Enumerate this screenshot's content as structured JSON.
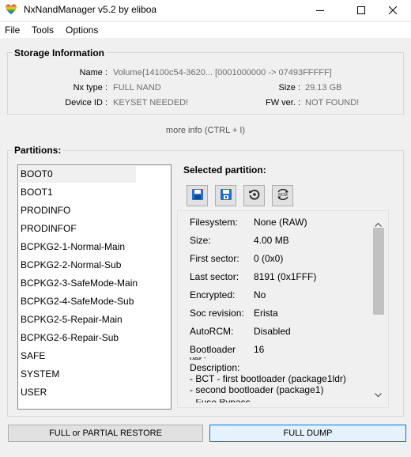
{
  "window": {
    "title": "NxNandManager v5.2 by eliboa",
    "minimize_icon": "minimize-icon",
    "maximize_icon": "maximize-icon",
    "close_icon": "close-icon"
  },
  "menu": {
    "items": [
      {
        "label": "File"
      },
      {
        "label": "Tools"
      },
      {
        "label": "Options"
      }
    ]
  },
  "storage": {
    "section_title": "Storage Information",
    "name_label": "Name :",
    "name_value": "Volume{14100c54-3620... [0001000000 -> 07493FFFFF]",
    "nx_type_label": "Nx type :",
    "nx_type_value": "FULL NAND",
    "size_label": "Size :",
    "size_value": "29.13 GB",
    "device_id_label": "Device ID :",
    "device_id_value": "KEYSET NEEDED!",
    "fw_ver_label": "FW ver. :",
    "fw_ver_value": "NOT FOUND!",
    "more_info": "more info (CTRL + I)"
  },
  "partitions": {
    "section_title": "Partitions:",
    "items": [
      "BOOT0",
      "BOOT1",
      "PRODINFO",
      "PRODINFOF",
      "BCPKG2-1-Normal-Main",
      "BCPKG2-2-Normal-Sub",
      "BCPKG2-3-SafeMode-Main",
      "BCPKG2-4-SafeMode-Sub",
      "BCPKG2-5-Repair-Main",
      "BCPKG2-6-Repair-Sub",
      "SAFE",
      "SYSTEM",
      "USER"
    ],
    "selected_index": 0
  },
  "selected_partition": {
    "title": "Selected partition:",
    "tools": [
      {
        "icon": "save-icon"
      },
      {
        "icon": "save-as-icon"
      },
      {
        "icon": "restore-icon"
      },
      {
        "icon": "autorcm-icon"
      }
    ],
    "fields": [
      {
        "label": "Filesystem:",
        "value": "None (RAW)"
      },
      {
        "label": "Size:",
        "value": "4.00 MB"
      },
      {
        "label": "First sector:",
        "value": "0 (0x0)"
      },
      {
        "label": "Last sector:",
        "value": "8191 (0x1FFF)"
      },
      {
        "label": "Encrypted:",
        "value": "No"
      },
      {
        "label": "Soc revision:",
        "value": "Erista"
      },
      {
        "label": "AutoRCM:",
        "value": "Disabled"
      },
      {
        "label": "Bootloader",
        "value": "16"
      }
    ],
    "cut_label": "ver.:",
    "description_label": "Description:",
    "description_lines": [
      "- BCT - first bootloader (package1ldr)",
      "- second bootloader (package1)",
      "- Fuse Bypass..."
    ]
  },
  "buttons": {
    "restore": "FULL or PARTIAL RESTORE",
    "dump": "FULL DUMP"
  },
  "colors": {
    "accent": "#0078d7",
    "dump_border": "#0078d7",
    "dump_bg": "#e5f1fb",
    "value_gray": "#6d6d6d"
  }
}
